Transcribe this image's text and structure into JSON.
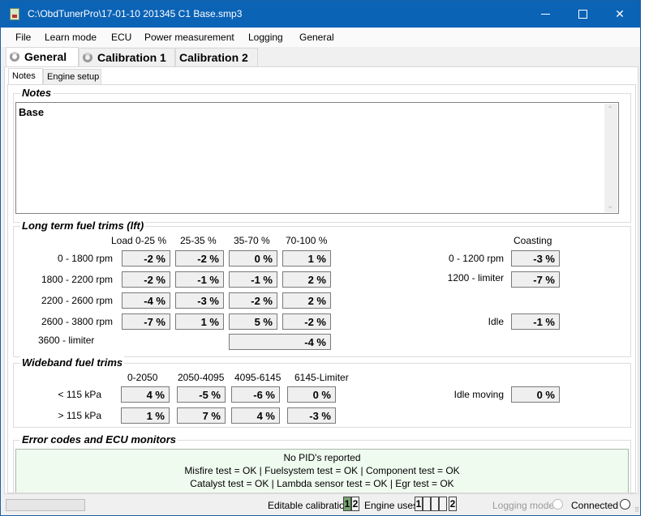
{
  "window": {
    "title": "C:\\ObdTunerPro\\17-01-10 201345 C1 Base.smp3",
    "controls": {
      "minimize": "minimize",
      "maximize": "maximize",
      "close": "✕"
    }
  },
  "menu": [
    "File",
    "Learn mode",
    "ECU",
    "Power measurement",
    "Logging",
    "General"
  ],
  "main_tabs": [
    {
      "label": "General",
      "icon": "refresh-icon",
      "active": true
    },
    {
      "label": "Calibration 1",
      "icon": "refresh-icon",
      "active": false
    },
    {
      "label": "Calibration 2",
      "active": false
    }
  ],
  "sub_tabs": [
    {
      "label": "Notes",
      "active": true
    },
    {
      "label": "Engine setup",
      "active": false
    }
  ],
  "notes": {
    "title": "Notes",
    "text": "Base",
    "scroll_up": "⌃",
    "scroll_down": "⌄"
  },
  "lft": {
    "title": "Long term fuel trims (lft)",
    "columns": [
      "Load 0-25 %",
      "25-35 %",
      "35-70 %",
      "70-100 %"
    ],
    "rows": [
      {
        "label": "0 - 1800 rpm",
        "values": [
          "-2 %",
          "-2 %",
          "0 %",
          "1 %"
        ]
      },
      {
        "label": "1800 - 2200 rpm",
        "values": [
          "-2 %",
          "-1 %",
          "-1 %",
          "2 %"
        ]
      },
      {
        "label": "2200 - 2600 rpm",
        "values": [
          "-4 %",
          "-3 %",
          "-2 %",
          "2 %"
        ]
      },
      {
        "label": "2600 - 3800 rpm",
        "values": [
          "-7 %",
          "1 %",
          "5 %",
          "-2 %"
        ]
      }
    ],
    "limiter": {
      "label": "3600 - limiter",
      "value": "-4 %"
    },
    "coasting": {
      "header": "Coasting",
      "rows": [
        {
          "label": "0 - 1200 rpm",
          "value": "-3 %"
        },
        {
          "label": "1200 - limiter",
          "value": "-7 %"
        }
      ]
    },
    "idle": {
      "label": "Idle",
      "value": "-1 %"
    }
  },
  "wideband": {
    "title": "Wideband fuel trims",
    "columns": [
      "0-2050",
      "2050-4095",
      "4095-6145",
      "6145-Limiter"
    ],
    "rows": [
      {
        "label": "< 115 kPa",
        "values": [
          "4 %",
          "-5 %",
          "-6 %",
          "0 %"
        ]
      },
      {
        "label": "> 115 kPa",
        "values": [
          "1 %",
          "7 %",
          "4 %",
          "-3 %"
        ]
      }
    ],
    "idle_moving": {
      "label": "Idle moving",
      "value": "0 %"
    }
  },
  "errors": {
    "title": "Error codes and ECU monitors",
    "lines": [
      "No PID's reported",
      "Misfire test = OK  |  Fuelsystem test = OK  |  Component test = OK",
      "Catalyst test = OK  |  Lambda sensor test = OK  |  Egr test = OK"
    ]
  },
  "status": {
    "editable_label": "Editable calibration",
    "editable_slots": [
      {
        "text": "1",
        "on": true
      },
      {
        "text": "2",
        "on": false
      }
    ],
    "engine_uses_label": "Engine uses",
    "engine_slots": [
      "1",
      "",
      "",
      "",
      "2"
    ],
    "logging_mode": "Logging mode",
    "connected": "Connected"
  },
  "colors": {
    "titlebar": "#0b63b6",
    "error_box_bg": "#f0fbf0",
    "active_slot": "#76a56e"
  }
}
